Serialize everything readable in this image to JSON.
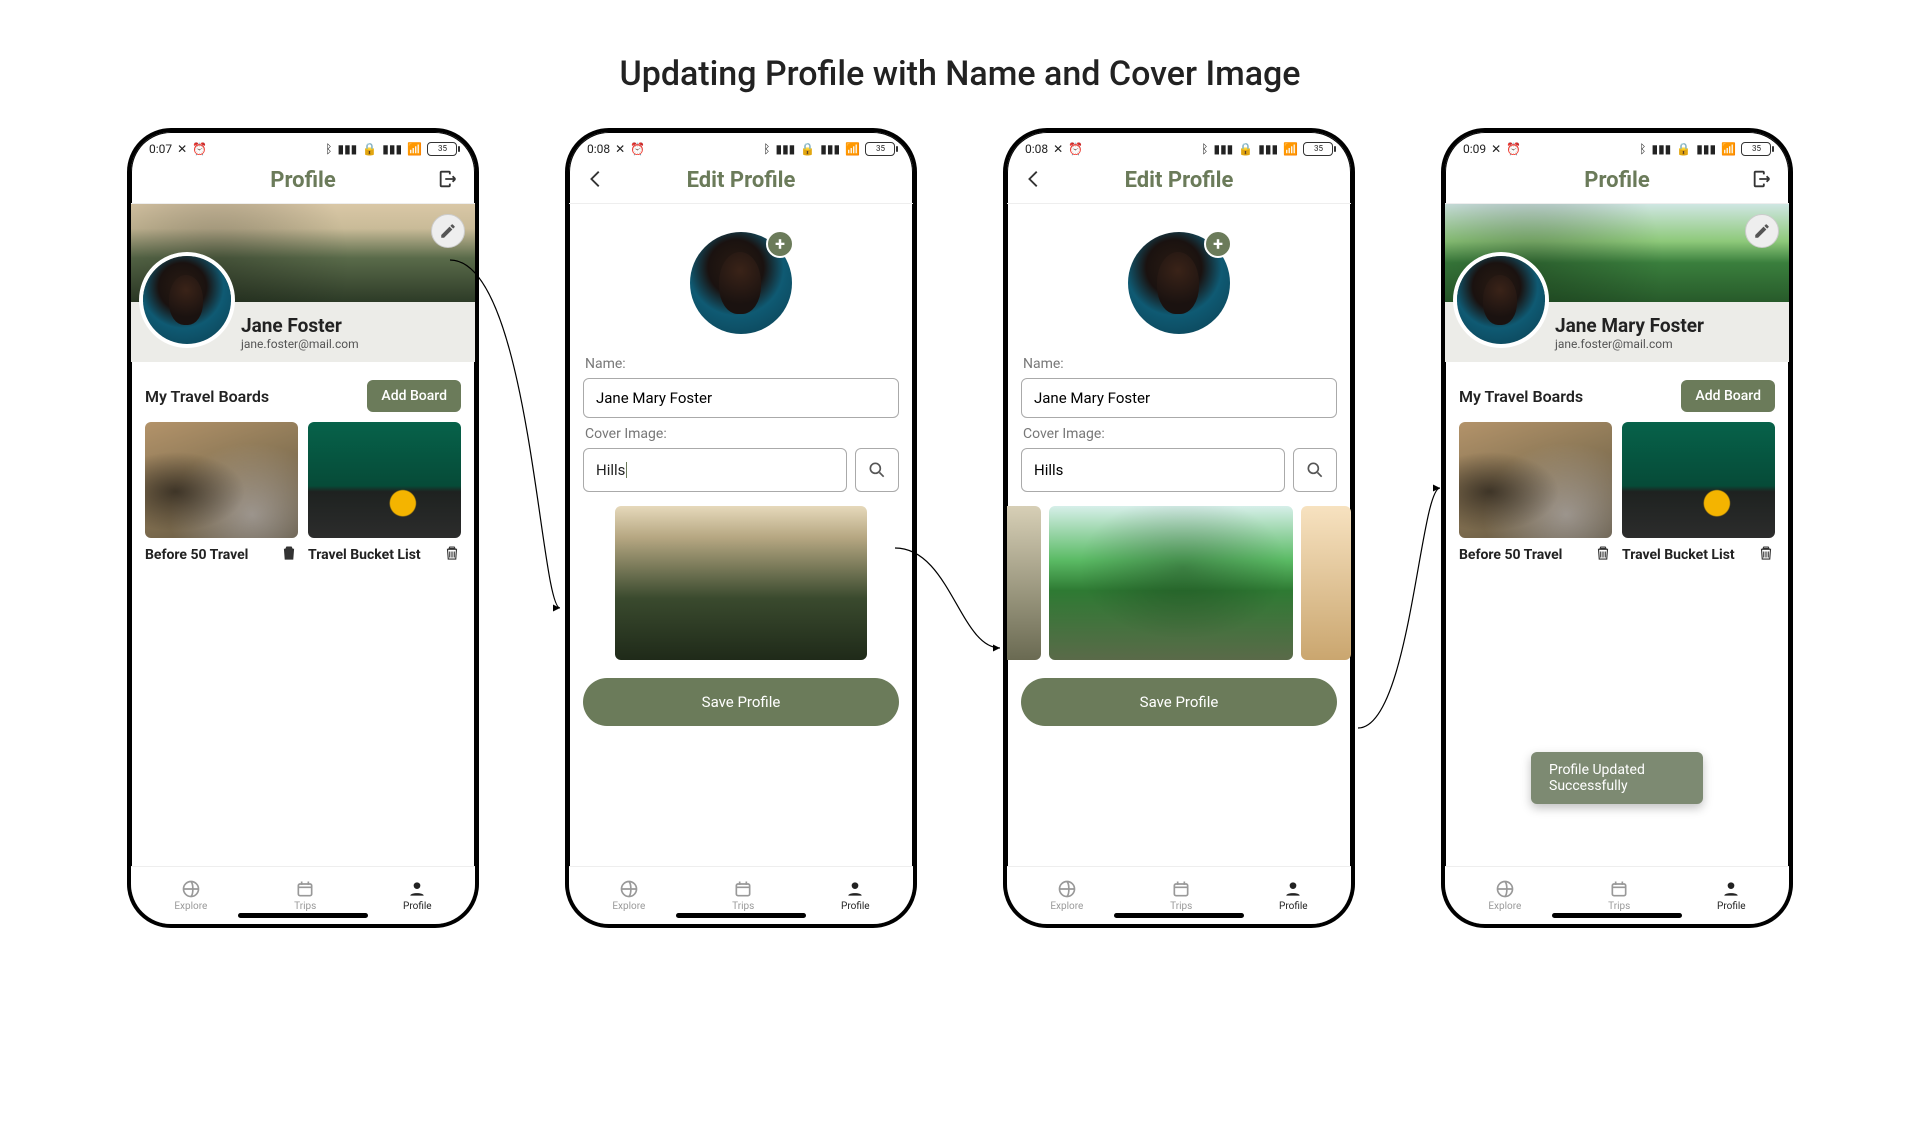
{
  "title": "Updating Profile with Name and Cover Image",
  "battery": "35",
  "tabs": {
    "explore": "Explore",
    "trips": "Trips",
    "profile": "Profile"
  },
  "profile": {
    "appbar_title": "Profile",
    "name_before": "Jane Foster",
    "name_after": "Jane Mary Foster",
    "email": "jane.foster@mail.com",
    "section": "My Travel Boards",
    "add_board": "Add Board",
    "boards": [
      {
        "name": "Before 50 Travel"
      },
      {
        "name": "Travel Bucket List"
      }
    ],
    "toast": "Profile Updated Successfully"
  },
  "edit": {
    "appbar_title": "Edit Profile",
    "name_label": "Name:",
    "name_value": "Jane Mary Foster",
    "cover_label": "Cover Image:",
    "cover_value_typing": "Hills",
    "cover_value_set": "Hills",
    "save": "Save Profile"
  },
  "status_times": [
    "0:07",
    "0:08",
    "0:08",
    "0:09"
  ]
}
